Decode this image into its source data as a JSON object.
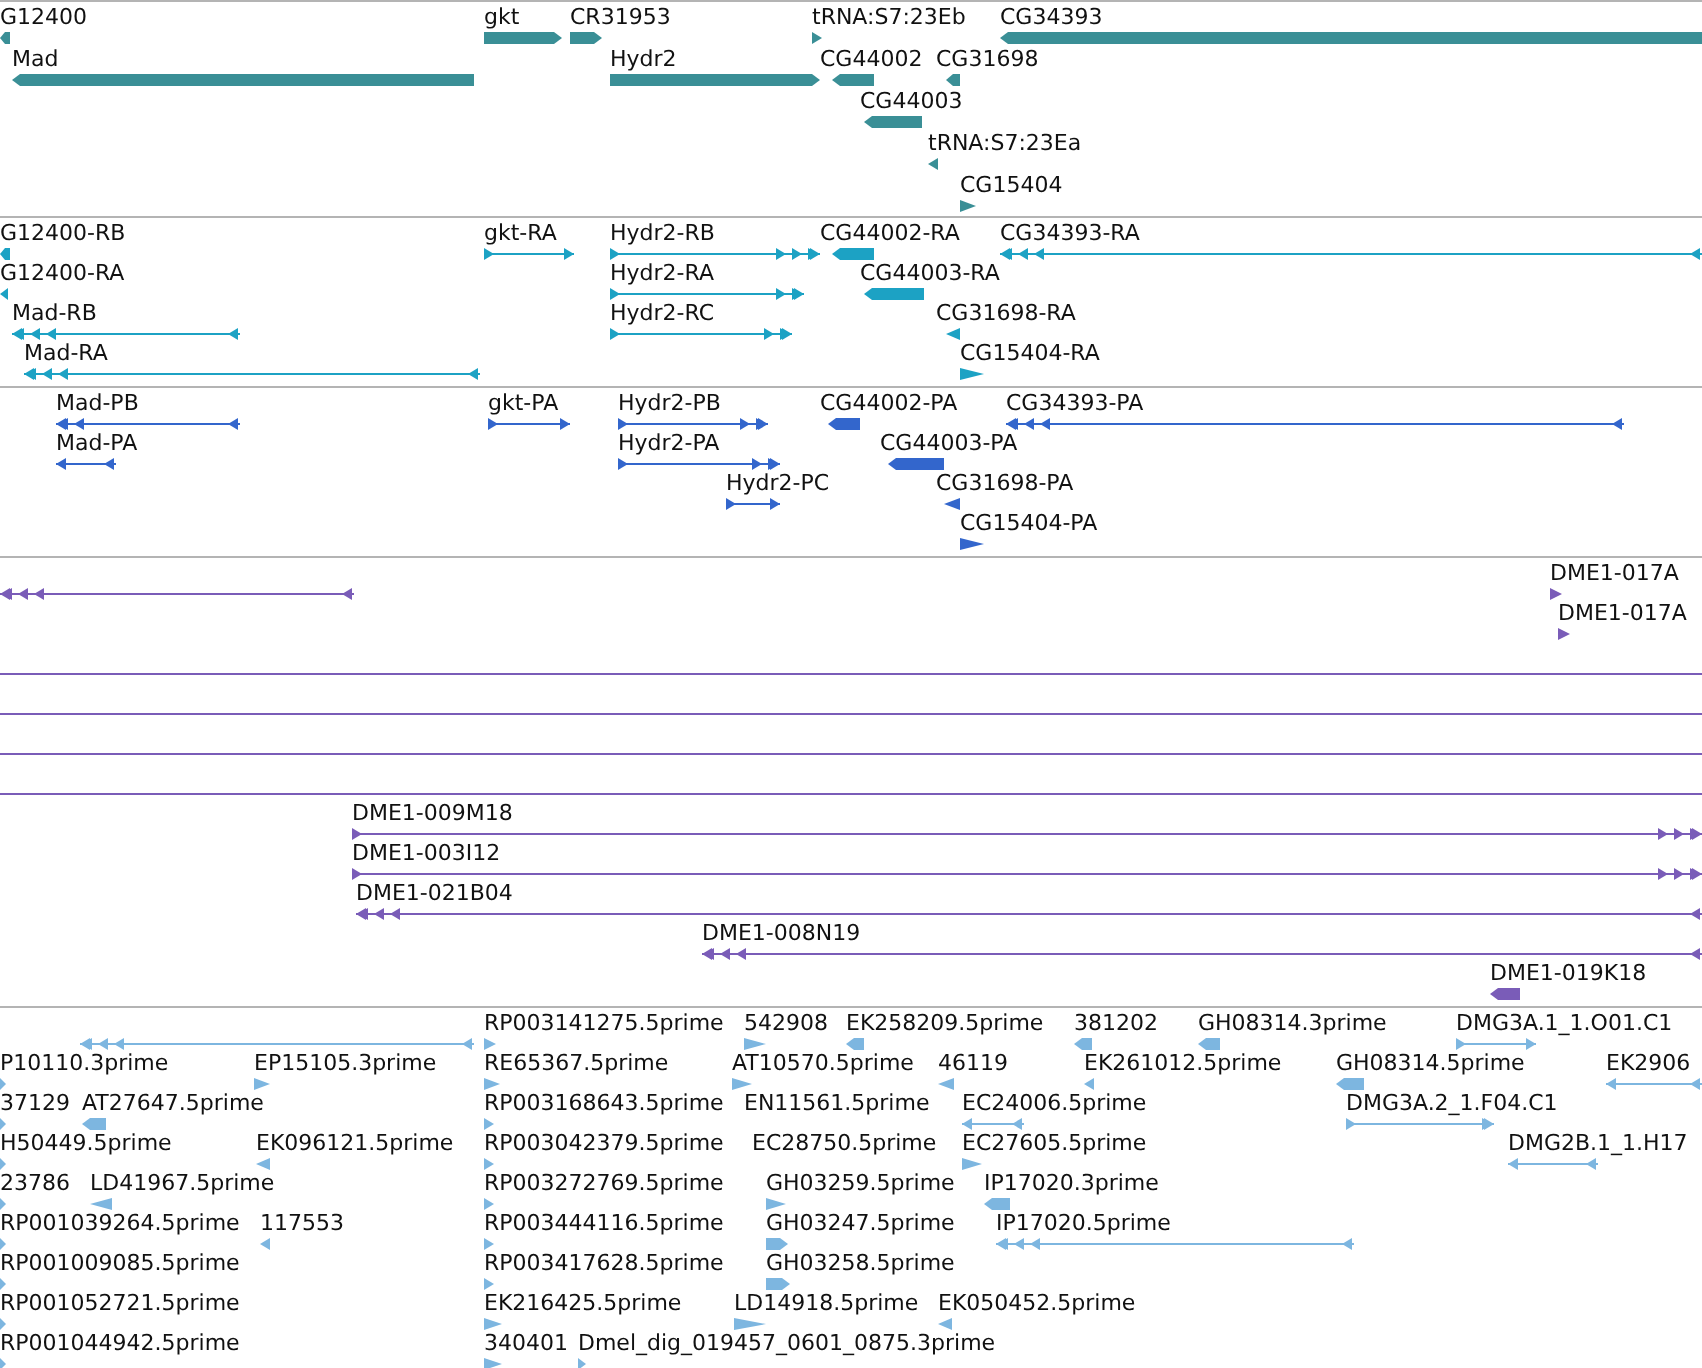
{
  "tracks": [
    {
      "color": "#3a8f96",
      "features": [
        {
          "label": "G12400",
          "kind": "bar",
          "reverse": true
        },
        {
          "label": "gkt",
          "kind": "bar",
          "reverse": false
        },
        {
          "label": "CR31953",
          "kind": "bar",
          "reverse": false
        },
        {
          "label": "tRNA:S7:23Eb",
          "kind": "marker",
          "reverse": false
        },
        {
          "label": "CG34393",
          "kind": "bar",
          "reverse": true
        },
        {
          "label": "Mad",
          "kind": "bar",
          "reverse": true
        },
        {
          "label": "Hydr2",
          "kind": "bar",
          "reverse": false
        },
        {
          "label": "CG44002",
          "kind": "bar",
          "reverse": true
        },
        {
          "label": "CG31698",
          "kind": "bar",
          "reverse": true
        },
        {
          "label": "CG44003",
          "kind": "bar",
          "reverse": true
        },
        {
          "label": "tRNA:S7:23Ea",
          "kind": "marker",
          "reverse": true
        },
        {
          "label": "CG15404",
          "kind": "marker",
          "reverse": false
        }
      ]
    },
    {
      "color": "#1ca2c4",
      "features": [
        {
          "label": "G12400-RB",
          "kind": "bar",
          "reverse": true
        },
        {
          "label": "G12400-RA",
          "kind": "marker",
          "reverse": true
        },
        {
          "label": "Mad-RB",
          "kind": "transcript",
          "reverse": true
        },
        {
          "label": "Mad-RA",
          "kind": "transcript",
          "reverse": true
        },
        {
          "label": "gkt-RA",
          "kind": "transcript",
          "reverse": false
        },
        {
          "label": "Hydr2-RB",
          "kind": "transcript",
          "reverse": false
        },
        {
          "label": "Hydr2-RA",
          "kind": "transcript",
          "reverse": false
        },
        {
          "label": "Hydr2-RC",
          "kind": "transcript",
          "reverse": false
        },
        {
          "label": "CG44002-RA",
          "kind": "bar",
          "reverse": true
        },
        {
          "label": "CG34393-RA",
          "kind": "transcript",
          "reverse": true
        },
        {
          "label": "CG44003-RA",
          "kind": "bar",
          "reverse": true
        },
        {
          "label": "CG31698-RA",
          "kind": "marker",
          "reverse": true
        },
        {
          "label": "CG15404-RA",
          "kind": "marker",
          "reverse": false
        }
      ]
    },
    {
      "color": "#3366cc",
      "features": [
        {
          "label": "Mad-PB",
          "kind": "transcript",
          "reverse": true
        },
        {
          "label": "Mad-PA",
          "kind": "transcript",
          "reverse": true
        },
        {
          "label": "gkt-PA",
          "kind": "transcript",
          "reverse": false
        },
        {
          "label": "Hydr2-PB",
          "kind": "transcript",
          "reverse": false
        },
        {
          "label": "Hydr2-PA",
          "kind": "transcript",
          "reverse": false
        },
        {
          "label": "Hydr2-PC",
          "kind": "transcript",
          "reverse": false
        },
        {
          "label": "CG44002-PA",
          "kind": "bar",
          "reverse": true
        },
        {
          "label": "CG34393-PA",
          "kind": "transcript",
          "reverse": true
        },
        {
          "label": "CG44003-PA",
          "kind": "bar",
          "reverse": true
        },
        {
          "label": "CG31698-PA",
          "kind": "marker",
          "reverse": true
        },
        {
          "label": "CG15404-PA",
          "kind": "marker",
          "reverse": false
        }
      ]
    },
    {
      "color": "#7a5cb8",
      "features": [
        {
          "kind": "transcript",
          "reverse": true
        },
        {
          "label": "DME1-017A",
          "kind": "marker",
          "reverse": false
        },
        {
          "label": "DME1-017A",
          "kind": "marker",
          "reverse": false
        },
        {
          "kind": "line"
        },
        {
          "kind": "line"
        },
        {
          "kind": "line"
        },
        {
          "kind": "line"
        },
        {
          "label": "DME1-009M18",
          "kind": "transcript",
          "reverse": false
        },
        {
          "label": "DME1-003I12",
          "kind": "transcript",
          "reverse": false
        },
        {
          "label": "DME1-021B04",
          "kind": "transcript",
          "reverse": true
        },
        {
          "label": "DME1-008N19",
          "kind": "transcript",
          "reverse": true
        },
        {
          "label": "DME1-019K18",
          "kind": "bar",
          "reverse": true
        }
      ]
    },
    {
      "color": "#7db6e0",
      "features": [
        {
          "kind": "transcript",
          "reverse": true
        },
        {
          "label": "RP003141275.5prime",
          "kind": "marker",
          "reverse": false
        },
        {
          "label": "542908",
          "kind": "marker",
          "reverse": false
        },
        {
          "label": "EK258209.5prime",
          "kind": "bar",
          "reverse": true
        },
        {
          "label": "381202",
          "kind": "bar",
          "reverse": true
        },
        {
          "label": "GH08314.3prime",
          "kind": "bar",
          "reverse": true
        },
        {
          "label": "DMG3A.1_1.O01.C1",
          "kind": "transcript",
          "reverse": false
        },
        {
          "label": "P10110.3prime",
          "kind": "marker",
          "reverse": false
        },
        {
          "label": "EP15105.3prime",
          "kind": "marker",
          "reverse": false
        },
        {
          "label": "RE65367.5prime",
          "kind": "marker",
          "reverse": false
        },
        {
          "label": "AT10570.5prime",
          "kind": "marker",
          "reverse": false
        },
        {
          "label": "46119",
          "kind": "marker",
          "reverse": true
        },
        {
          "label": "EK261012.5prime",
          "kind": "marker",
          "reverse": true
        },
        {
          "label": "GH08314.5prime",
          "kind": "bar",
          "reverse": true
        },
        {
          "label": "EK2906",
          "kind": "transcript",
          "reverse": true
        },
        {
          "label": "37129",
          "kind": "marker",
          "reverse": false
        },
        {
          "label": "AT27647.5prime",
          "kind": "bar",
          "reverse": true
        },
        {
          "label": "RP003168643.5prime",
          "kind": "marker",
          "reverse": false
        },
        {
          "label": "EN11561.5prime"
        },
        {
          "label": "EC24006.5prime",
          "kind": "transcript",
          "reverse": true
        },
        {
          "label": "DMG3A.2_1.F04.C1",
          "kind": "transcript",
          "reverse": false
        },
        {
          "label": "H50449.5prime",
          "kind": "marker",
          "reverse": false
        },
        {
          "label": "EK096121.5prime",
          "kind": "marker",
          "reverse": true
        },
        {
          "label": "RP003042379.5prime",
          "kind": "marker",
          "reverse": false
        },
        {
          "label": "EC28750.5prime"
        },
        {
          "label": "EC27605.5prime",
          "kind": "marker",
          "reverse": false
        },
        {
          "label": "DMG2B.1_1.H17",
          "kind": "transcript",
          "reverse": true
        },
        {
          "label": "23786",
          "kind": "marker",
          "reverse": false
        },
        {
          "label": "LD41967.5prime",
          "kind": "marker",
          "reverse": true
        },
        {
          "label": "RP003272769.5prime",
          "kind": "marker",
          "reverse": false
        },
        {
          "label": "GH03259.5prime",
          "kind": "marker",
          "reverse": false
        },
        {
          "label": "IP17020.3prime",
          "kind": "bar",
          "reverse": true
        },
        {
          "label": "RP001039264.5prime",
          "kind": "marker",
          "reverse": false
        },
        {
          "label": "117553",
          "kind": "marker",
          "reverse": true
        },
        {
          "label": "RP003444116.5prime",
          "kind": "marker",
          "reverse": false
        },
        {
          "label": "GH03247.5prime",
          "kind": "bar",
          "reverse": false
        },
        {
          "label": "IP17020.5prime",
          "kind": "transcript",
          "reverse": true
        },
        {
          "label": "RP001009085.5prime",
          "kind": "marker",
          "reverse": false
        },
        {
          "label": "RP003417628.5prime",
          "kind": "marker",
          "reverse": false
        },
        {
          "label": "GH03258.5prime",
          "kind": "bar",
          "reverse": false
        },
        {
          "label": "RP001052721.5prime",
          "kind": "marker",
          "reverse": false
        },
        {
          "label": "EK216425.5prime",
          "kind": "marker",
          "reverse": false
        },
        {
          "label": "LD14918.5prime",
          "kind": "marker",
          "reverse": false
        },
        {
          "label": "EK050452.5prime",
          "kind": "marker",
          "reverse": true
        },
        {
          "label": "RP001044942.5prime",
          "kind": "marker",
          "reverse": false
        },
        {
          "label": "340401",
          "kind": "marker",
          "reverse": false
        },
        {
          "label": "Dmel_dig_019457_0601_0875.3prime",
          "kind": "marker",
          "reverse": false
        }
      ]
    }
  ]
}
